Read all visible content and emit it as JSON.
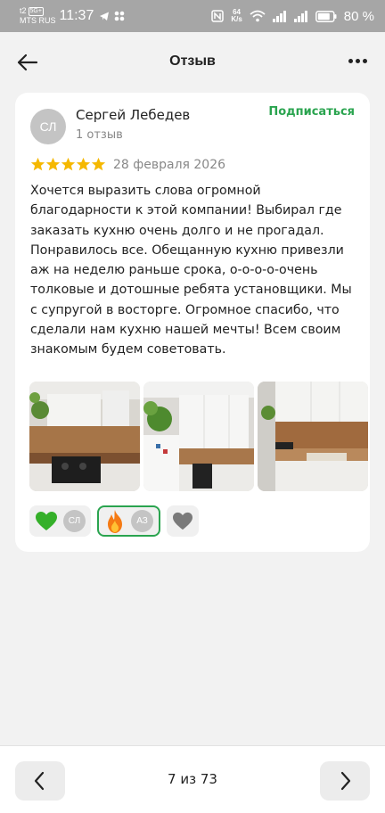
{
  "status_bar": {
    "signal_label": "t2",
    "network_tag": "5G+",
    "carrier": "MTS RUS",
    "time": "11:37",
    "speed_value": "64",
    "speed_unit": "K/s",
    "battery": "80 %"
  },
  "header": {
    "title": "Отзыв"
  },
  "review": {
    "author_initials": "СЛ",
    "author_name": "Сергей Лебедев",
    "author_reviews": "1 отзыв",
    "subscribe_label": "Подписаться",
    "rating": 5,
    "date": "28 февраля 2026",
    "text": "Хочется выразить слова огромной благодарности к этой компании! Выбирал где заказать кухню очень долго и не прогадал. Понравилось все. Обещанную кухню привезли аж на неделю раньше срока, о-о-о-о-очень толковые и дотошные ребята установщики. Мы с супругой в восторге. Огромное спасибо, что сделали нам кухню нашей мечты! Всем своим знакомым будем советовать.",
    "photos": [
      {
        "name": "kitchen-photo-1"
      },
      {
        "name": "kitchen-photo-2"
      },
      {
        "name": "kitchen-photo-3"
      }
    ],
    "reactions": [
      {
        "icon": "green-heart-icon",
        "initials": "СЛ",
        "active": false
      },
      {
        "icon": "fire-icon",
        "initials": "АЗ",
        "active": true
      },
      {
        "icon": "gray-heart-icon",
        "initials": "",
        "active": false
      }
    ]
  },
  "pager": {
    "text": "7 из 73"
  },
  "colors": {
    "accent_green": "#2aa44f",
    "star_yellow": "#f5b800",
    "status_bar": "#a6a6a6"
  }
}
